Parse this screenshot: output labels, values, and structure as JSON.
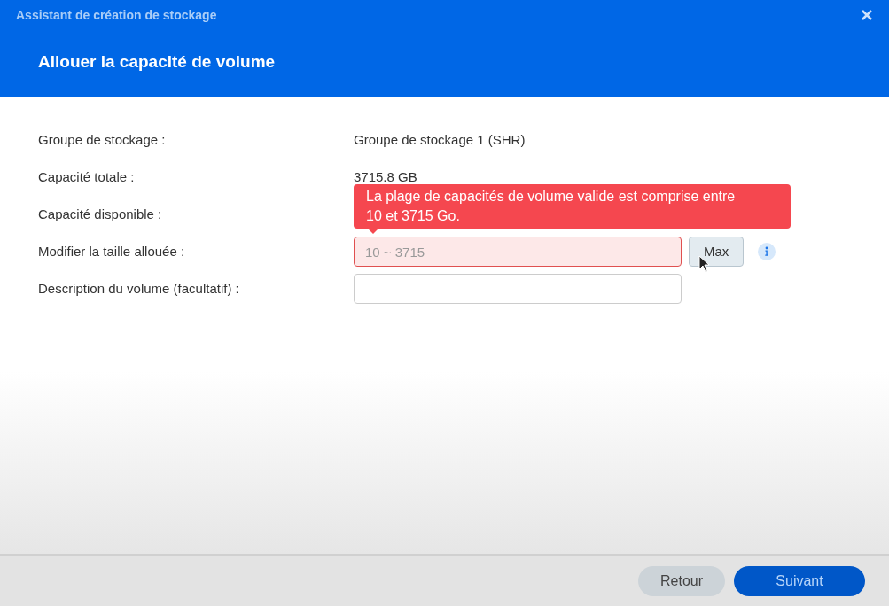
{
  "window": {
    "title": "Assistant de création de stockage"
  },
  "header": {
    "title": "Allouer la capacité de volume"
  },
  "rows": [
    {
      "kind": "text",
      "label": "Groupe de stockage :",
      "value": "Groupe de stockage 1 (SHR)"
    },
    {
      "kind": "text",
      "label": "Capacité totale :",
      "value": "3715.8 GB"
    },
    {
      "kind": "hidden",
      "label": "Capacité disponible :"
    },
    {
      "kind": "size",
      "label": "Modifier la taille allouée :",
      "placeholder": "10 ~ 3715",
      "error": true,
      "button": "Max"
    },
    {
      "kind": "input",
      "label": "Description du volume (facultatif) :"
    }
  ],
  "error_tooltip": "La plage de capacités de volume valide est comprise entre 10 et 3715 Go.",
  "footer": {
    "back": "Retour",
    "next": "Suivant"
  }
}
